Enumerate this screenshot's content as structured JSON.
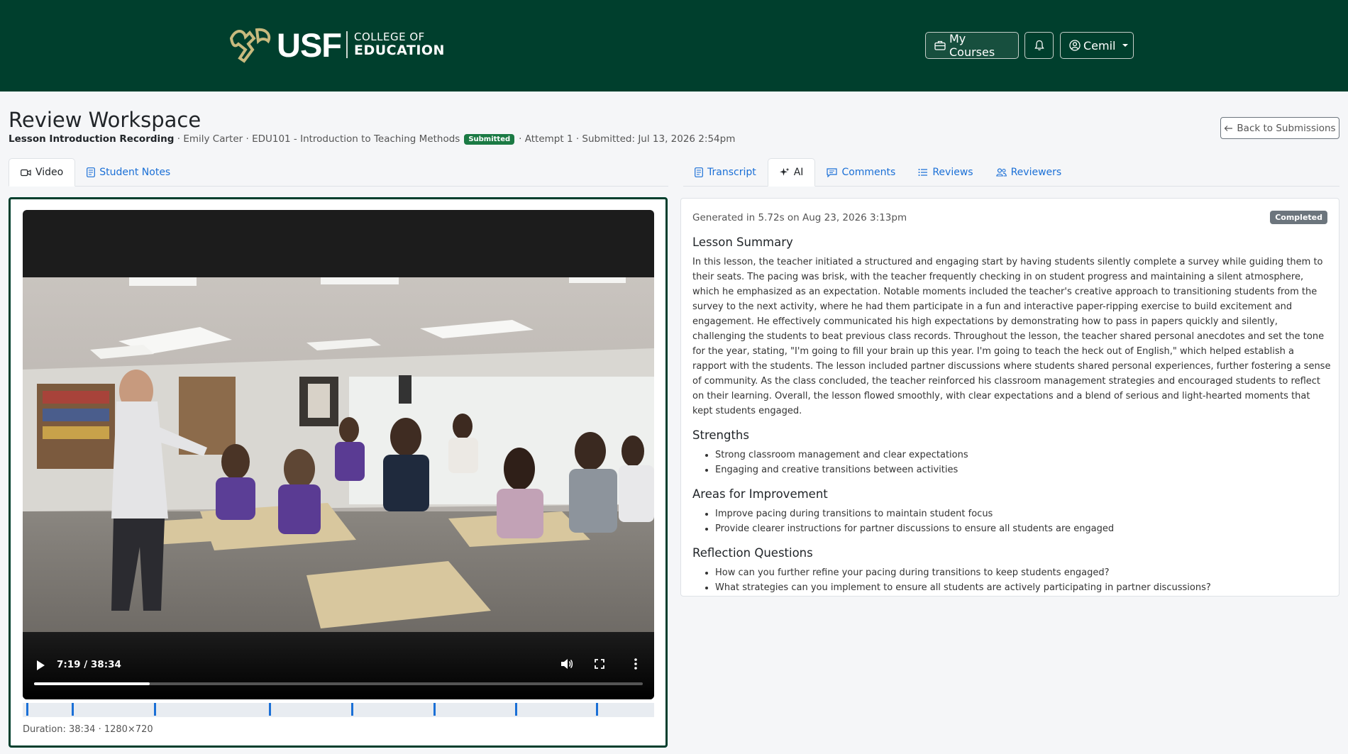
{
  "header": {
    "logo_usf": "USF",
    "logo_line1": "COLLEGE OF",
    "logo_line2": "EDUCATION",
    "my_courses": "My Courses",
    "user_name": "Cemil"
  },
  "page": {
    "title": "Review Workspace",
    "lesson": "Lesson Introduction Recording",
    "student": "Emily Carter",
    "course": "EDU101 - Introduction to Teaching Methods",
    "status": "Submitted",
    "attempt": "Attempt 1",
    "submitted": "Submitted: Jul 13, 2026 2:54pm",
    "back_label": "Back to Submissions"
  },
  "left_tabs": [
    {
      "label": "Video",
      "icon": "video-icon"
    },
    {
      "label": "Student Notes",
      "icon": "document-icon"
    }
  ],
  "right_tabs": [
    {
      "label": "Transcript",
      "icon": "document-icon"
    },
    {
      "label": "AI",
      "icon": "sparkle-icon"
    },
    {
      "label": "Comments",
      "icon": "comment-icon"
    },
    {
      "label": "Reviews",
      "icon": "list-icon"
    },
    {
      "label": "Reviewers",
      "icon": "people-icon"
    }
  ],
  "video": {
    "time": "7:19 / 38:34",
    "progress": 0.19,
    "markers": [
      0.006,
      0.078,
      0.208,
      0.39,
      0.52,
      0.65,
      0.78,
      0.908
    ],
    "duration_text": "Duration: 38:34 · 1280×720"
  },
  "ai": {
    "generated": "Generated in 5.72s on Aug 23, 2026 3:13pm",
    "status": "Completed",
    "summary_title": "Lesson Summary",
    "summary": "In this lesson, the teacher initiated a structured and engaging start by having students silently complete a survey while guiding them to their seats. The pacing was brisk, with the teacher frequently checking in on student progress and maintaining a silent atmosphere, which he emphasized as an expectation. Notable moments included the teacher's creative approach to transitioning students from the survey to the next activity, where he had them participate in a fun and interactive paper-ripping exercise to build excitement and engagement. He effectively communicated his high expectations by demonstrating how to pass in papers quickly and silently, challenging the students to beat previous class records. Throughout the lesson, the teacher shared personal anecdotes and set the tone for the year, stating, \"I'm going to fill your brain up this year. I'm going to teach the heck out of English,\" which helped establish a rapport with the students. The lesson included partner discussions where students shared personal experiences, further fostering a sense of community. As the class concluded, the teacher reinforced his classroom management strategies and encouraged students to reflect on their learning. Overall, the lesson flowed smoothly, with clear expectations and a blend of serious and light-hearted moments that kept students engaged.",
    "strengths_title": "Strengths",
    "strengths": [
      "Strong classroom management and clear expectations",
      "Engaging and creative transitions between activities"
    ],
    "improve_title": "Areas for Improvement",
    "improve": [
      "Improve pacing during transitions to maintain student focus",
      "Provide clearer instructions for partner discussions to ensure all students are engaged"
    ],
    "reflect_title": "Reflection Questions",
    "reflect": [
      "How can you further refine your pacing during transitions to keep students engaged?",
      "What strategies can you implement to ensure all students are actively participating in partner discussions?"
    ]
  }
}
